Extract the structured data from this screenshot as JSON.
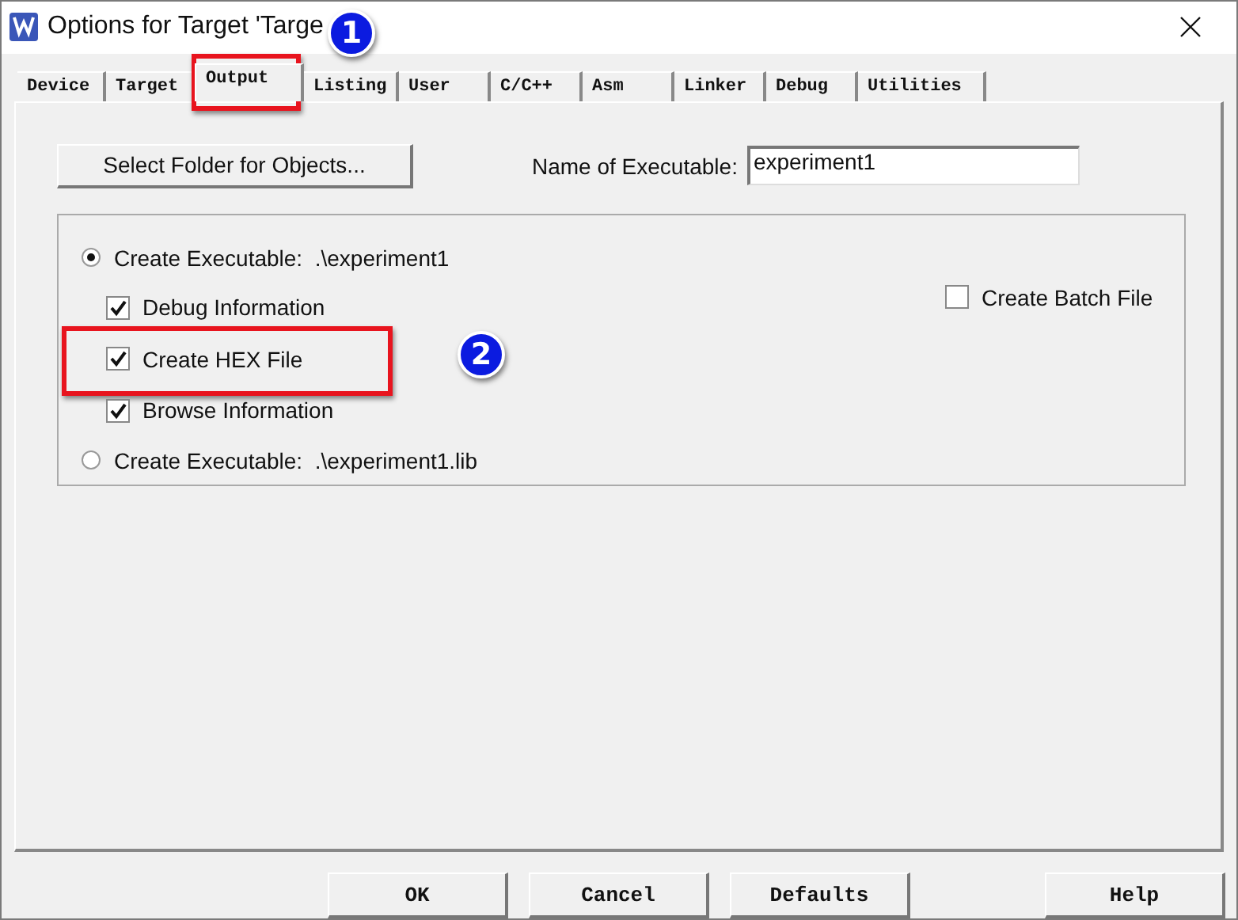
{
  "window": {
    "title": "Options for Target 'Targe"
  },
  "tabs": [
    {
      "label": "Device",
      "selected": false
    },
    {
      "label": "Target",
      "selected": false
    },
    {
      "label": "Output",
      "selected": true,
      "marker": "1"
    },
    {
      "label": "Listing",
      "selected": false
    },
    {
      "label": "User",
      "selected": false
    },
    {
      "label": "C/C++",
      "selected": false
    },
    {
      "label": "Asm",
      "selected": false
    },
    {
      "label": "Linker",
      "selected": false
    },
    {
      "label": "Debug",
      "selected": false
    },
    {
      "label": "Utilities",
      "selected": false
    }
  ],
  "select_folder_button": "Select Folder for Objects...",
  "executable_name": {
    "label": "Name of Executable:",
    "value": "experiment1"
  },
  "options": [
    {
      "kind": "radio",
      "label": "Create Executable:  .\\experiment1",
      "selected": true,
      "children": [
        {
          "kind": "checkbox",
          "label": "Debug Information",
          "checked": true
        },
        {
          "kind": "checkbox",
          "label": "Create HEX File",
          "checked": true,
          "marker": "2"
        },
        {
          "kind": "checkbox",
          "label": "Browse Information",
          "checked": true
        }
      ]
    },
    {
      "kind": "radio",
      "label": "Create Executable:  .\\experiment1.lib",
      "selected": false
    }
  ],
  "batch_file": {
    "label": "Create Batch File",
    "checked": false
  },
  "buttons": [
    "OK",
    "Cancel",
    "Defaults",
    "Help"
  ]
}
